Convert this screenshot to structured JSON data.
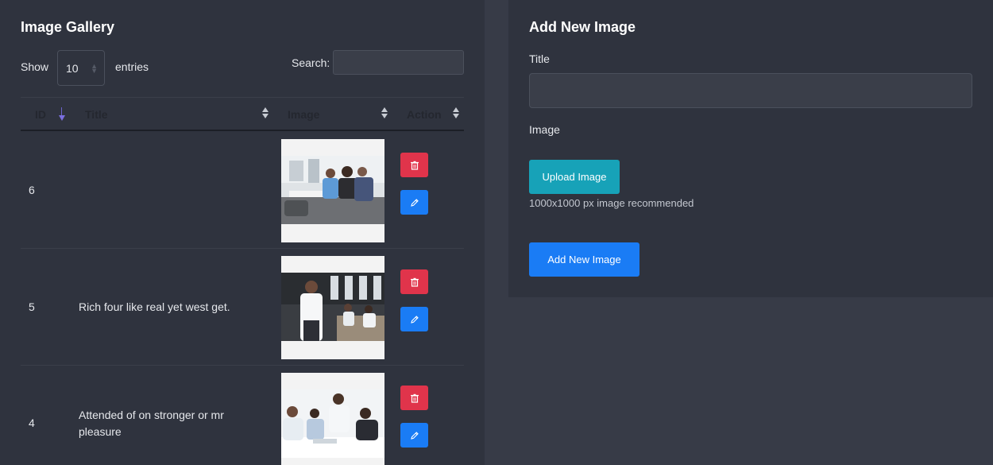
{
  "gallery": {
    "title": "Image Gallery",
    "show_label": "Show",
    "entries_value": "10",
    "entries_label": "entries",
    "search_label": "Search:",
    "search_value": "",
    "columns": [
      "ID",
      "Title",
      "Image",
      "Action"
    ],
    "rows": [
      {
        "id": "6",
        "title": "",
        "image": "office-team-photo"
      },
      {
        "id": "5",
        "title": "Rich four like real yet west get.",
        "image": "businessman-office-photo"
      },
      {
        "id": "4",
        "title": "Attended of on stronger or mr pleasure",
        "image": "team-meeting-photo"
      }
    ]
  },
  "form": {
    "title": "Add New Image",
    "title_label": "Title",
    "title_value": "",
    "image_label": "Image",
    "upload_label": "Upload Image",
    "hint": "1000x1000 px image recommended",
    "submit_label": "Add New Image"
  },
  "colors": {
    "page_bg": "#373b47",
    "card_bg": "#2f333e",
    "delete": "#e0344b",
    "edit": "#1a7cf5",
    "upload": "#17a2b8",
    "primary": "#1a7cf5"
  },
  "icons": [
    "trash-icon",
    "pencil-icon",
    "sort-icon"
  ]
}
